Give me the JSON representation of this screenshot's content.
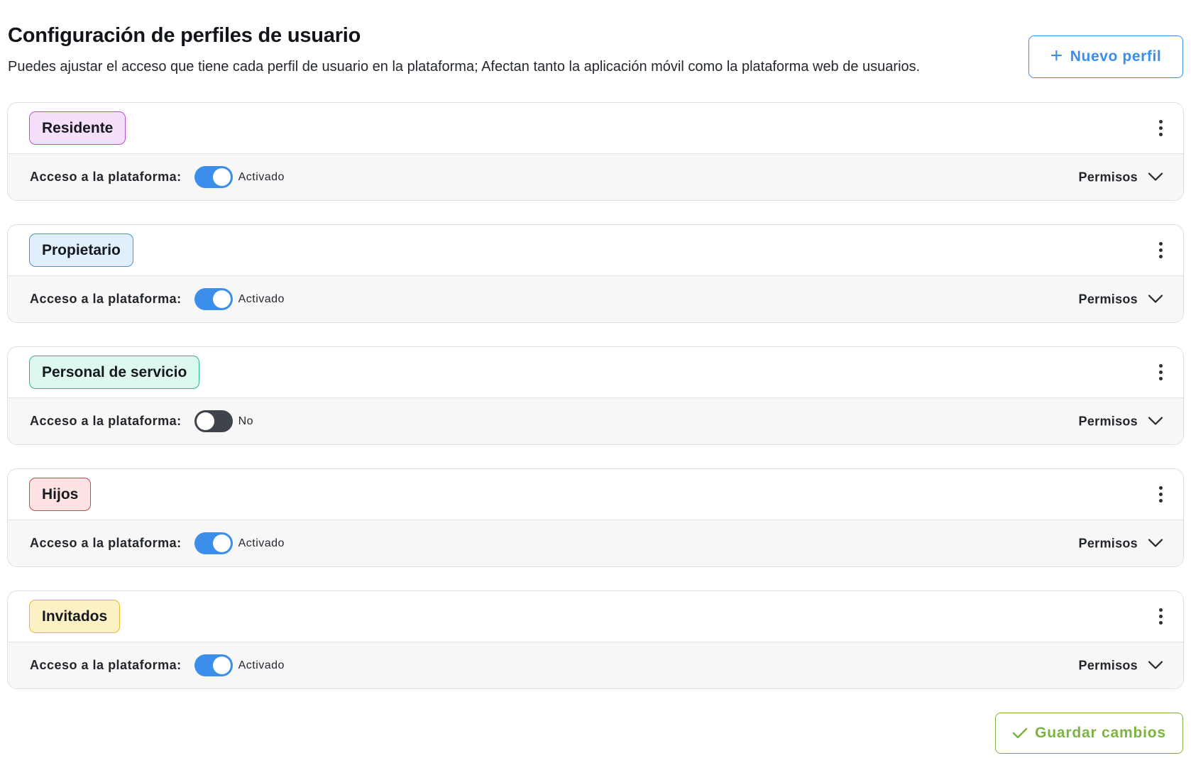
{
  "header": {
    "title": "Configuración de perfiles de usuario",
    "description": "Puedes ajustar el acceso que tiene cada perfil de usuario en la plataforma; Afectan tanto la aplicación móvil como la plataforma web de usuarios.",
    "new_profile_icon": "plus-icon",
    "new_profile_label": "Nuevo perfil"
  },
  "profiles": [
    {
      "name": "Residente",
      "tag_bg": "#f6dffb",
      "tag_border": "#c04bd8",
      "access_label": "Acceso a la plataforma:",
      "access_enabled": true,
      "access_state": "Activado",
      "permissions_label": "Permisos"
    },
    {
      "name": "Propietario",
      "tag_bg": "#e1eefb",
      "tag_border": "#4a90d9",
      "access_label": "Acceso a la plataforma:",
      "access_enabled": true,
      "access_state": "Activado",
      "permissions_label": "Permisos"
    },
    {
      "name": "Personal de servicio",
      "tag_bg": "#dcf8ef",
      "tag_border": "#2fb88a",
      "access_label": "Acceso a la plataforma:",
      "access_enabled": false,
      "access_state": "No",
      "permissions_label": "Permisos"
    },
    {
      "name": "Hijos",
      "tag_bg": "#fde3e4",
      "tag_border": "#d6414a",
      "access_label": "Acceso a la plataforma:",
      "access_enabled": true,
      "access_state": "Activado",
      "permissions_label": "Permisos"
    },
    {
      "name": "Invitados",
      "tag_bg": "#fcf1c4",
      "tag_border": "#e8b92a",
      "access_label": "Acceso a la plataforma:",
      "access_enabled": true,
      "access_state": "Activado",
      "permissions_label": "Permisos"
    }
  ],
  "footer": {
    "save_icon": "check-icon",
    "save_label": "Guardar cambios"
  },
  "colors": {
    "accent_blue": "#3b8eea",
    "toggle_off": "#3f434b",
    "save_green": "#7cb342"
  }
}
